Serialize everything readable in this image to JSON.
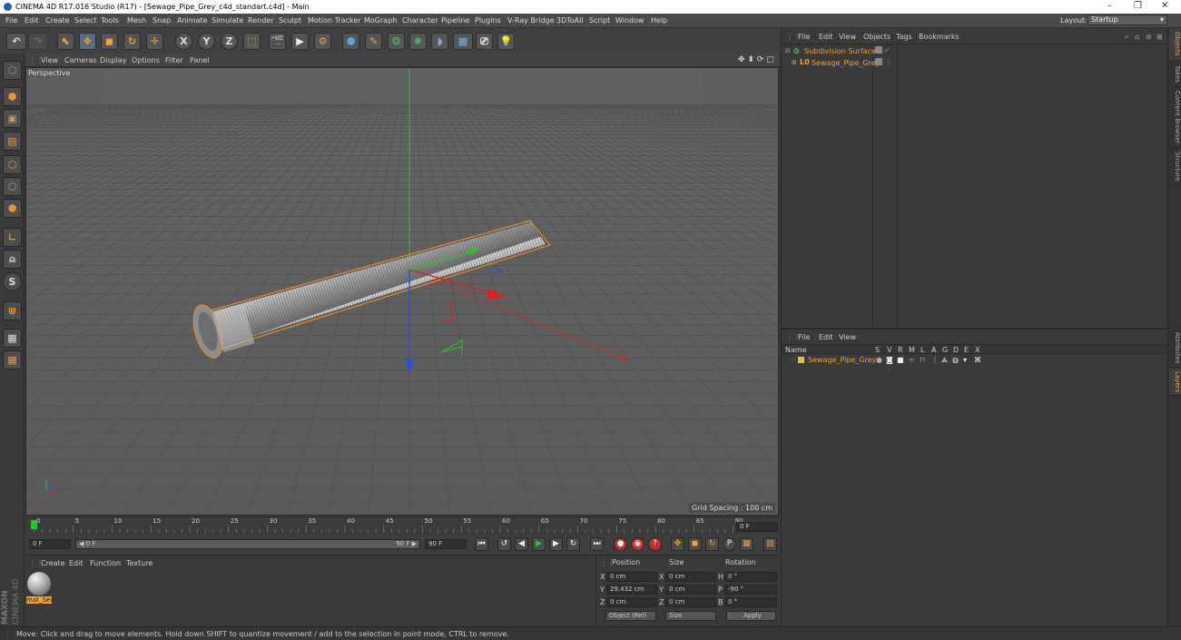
{
  "window": {
    "title": "CINEMA 4D R17.016 Studio (R17) - [Sewage_Pipe_Grey_c4d_standart.c4d] - Main",
    "controls": [
      "–",
      "❐",
      "✕"
    ]
  },
  "menubar": {
    "items": [
      "File",
      "Edit",
      "Create",
      "Select",
      "Tools",
      "Mesh",
      "Snap",
      "Animate",
      "Simulate",
      "Render",
      "Sculpt",
      "Motion Tracker",
      "MoGraph",
      "Character",
      "Pipeline",
      "Plugins",
      "V-Ray Bridge",
      "3DToAll",
      "Script",
      "Window",
      "Help"
    ],
    "layout_label": "Layout:",
    "layout_value": "Startup"
  },
  "toolbar": {
    "icons": [
      "undo-icon",
      "redo-icon",
      "select-icon",
      "move-icon",
      "scale-icon",
      "rotate-icon",
      "last-tool-icon",
      "x-axis-icon",
      "y-axis-icon",
      "z-axis-icon",
      "coord-system-icon",
      "render-view-icon",
      "render-picture-viewer-icon",
      "render-settings-icon",
      "cube-icon",
      "pen-icon",
      "subdivision-icon",
      "cloner-icon",
      "deformer-icon",
      "floor-icon",
      "camera-icon",
      "light-icon"
    ],
    "glyphs": {
      "x": "X",
      "y": "Y",
      "z": "Z"
    }
  },
  "lefttools": {
    "icons": [
      "make-editable-icon",
      "model-mode-icon",
      "texture-mode-icon",
      "workplane-icon",
      "points-mode-icon",
      "edges-mode-icon",
      "polygons-mode-icon",
      "axis-mode-icon",
      "tweak-icon",
      "snap-icon",
      "magnet-icon",
      "lock-workplane-icon",
      "planar-workplane-icon"
    ],
    "glyphs": {
      "snap": "S"
    }
  },
  "viewport": {
    "menu": [
      "View",
      "Cameras",
      "Display",
      "Options",
      "Filter",
      "Panel"
    ],
    "label": "Perspective",
    "grid_spacing": "Grid Spacing : 100 cm",
    "nav_glyphs": "✥ ⬍ ⟳ ▢"
  },
  "timeline": {
    "ticks": [
      "0",
      "5",
      "10",
      "15",
      "20",
      "25",
      "30",
      "35",
      "40",
      "45",
      "50",
      "55",
      "60",
      "65",
      "70",
      "75",
      "80",
      "85",
      "90"
    ],
    "current_frame": "0 F"
  },
  "playbar": {
    "start_field": "0 F",
    "range_start": "◀ 0 F",
    "range_end": "90 F ▶",
    "end_field": "90 F",
    "end_field2": "90 F"
  },
  "material_manager": {
    "menu": [
      "Create",
      "Edit",
      "Function",
      "Texture"
    ],
    "material_name": "mat_Sev",
    "brand": "MAXON",
    "brand2": "CINEMA 4D"
  },
  "coordinates": {
    "headers": [
      "Position",
      "Size",
      "Rotation"
    ],
    "rows": [
      {
        "axis": "X",
        "pos": "0 cm",
        "size_axis": "X",
        "size": "0 cm",
        "rot_axis": "H",
        "rot": "0 °"
      },
      {
        "axis": "Y",
        "pos": "29.432 cm",
        "size_axis": "Y",
        "size": "0 cm",
        "rot_axis": "P",
        "rot": "-90 °"
      },
      {
        "axis": "Z",
        "pos": "0 cm",
        "size_axis": "Z",
        "size": "0 cm",
        "rot_axis": "B",
        "rot": "0 °"
      }
    ],
    "mode": "Object (Rel)",
    "size_mode": "Size",
    "apply": "Apply"
  },
  "object_manager": {
    "menu": [
      "File",
      "Edit",
      "View",
      "Objects",
      "Tags",
      "Bookmarks"
    ],
    "objects": [
      {
        "name": "Subdivision Surface",
        "level": 0
      },
      {
        "name": "Sewage_Pipe_Grey",
        "level": 1
      }
    ],
    "check": "✓"
  },
  "layer_manager": {
    "menu": [
      "File",
      "Edit",
      "View"
    ],
    "columns": [
      "Name",
      "S",
      "V",
      "R",
      "M",
      "L",
      "A",
      "G",
      "D",
      "E",
      "X"
    ],
    "layers": [
      {
        "name": "Sewage_Pipe_Grey",
        "color": "#e6c21a"
      }
    ]
  },
  "right_tabs": [
    "Objects",
    "Takes",
    "Content Browser",
    "Structure",
    "Attributes",
    "Layers"
  ],
  "status": {
    "text": "Move: Click and drag to move elements. Hold down SHIFT to quantize movement / add to the selection in point mode, CTRL to remove."
  },
  "colors": {
    "accent": "#f2a230",
    "x_axis": "#e02020",
    "y_axis": "#2ec22e",
    "z_axis": "#2a4ee0",
    "selection_outline": "#e88a2a"
  }
}
